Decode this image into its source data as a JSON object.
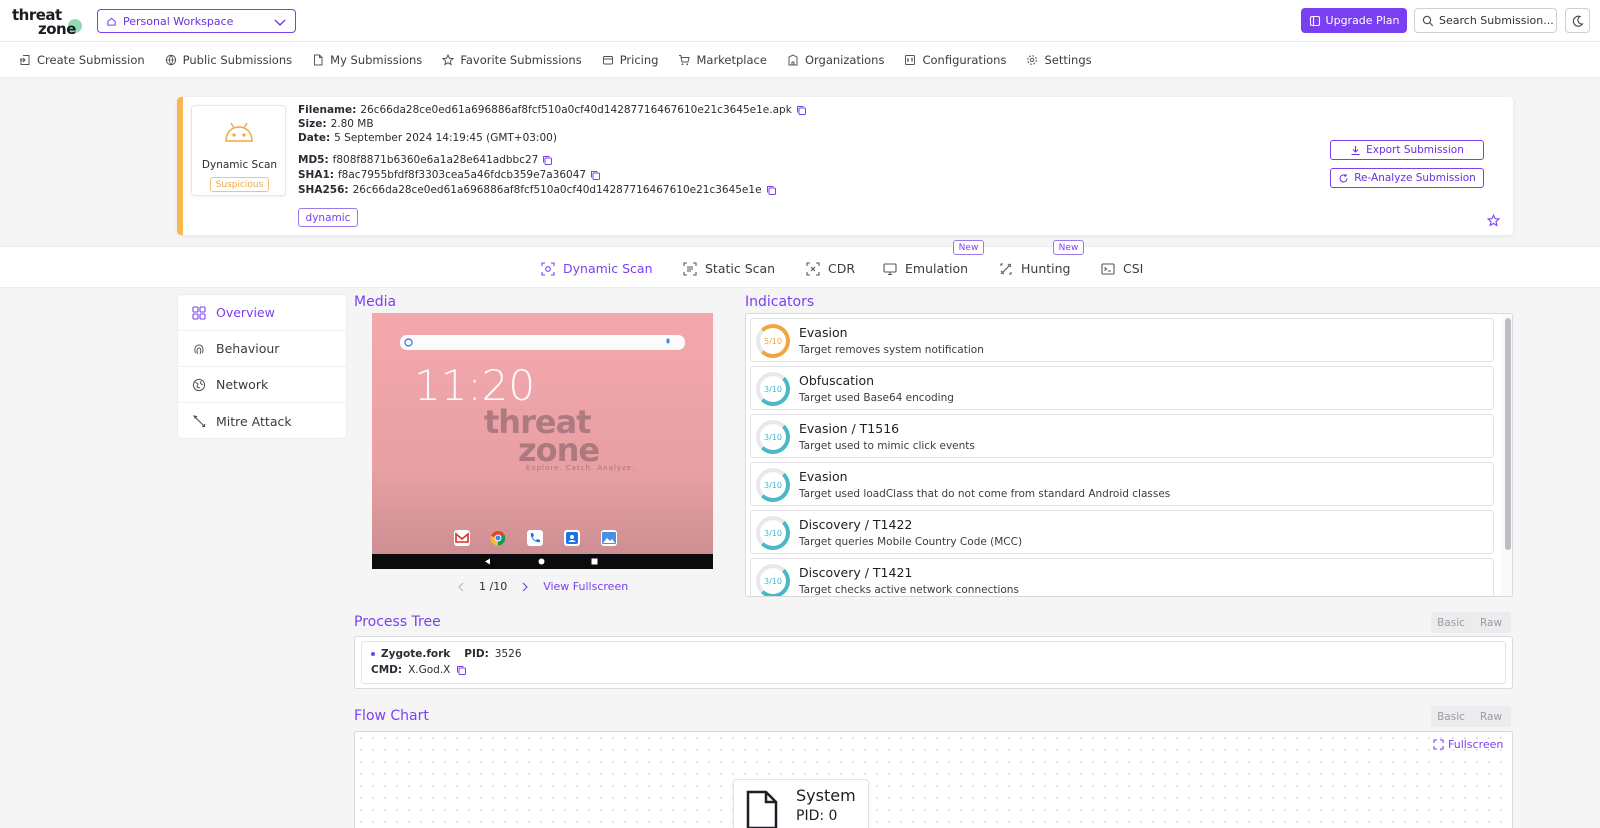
{
  "brand": {
    "logo_line1": "threat",
    "logo_line2": "zone"
  },
  "header": {
    "workspace": "Personal Workspace",
    "upgrade_label": "Upgrade Plan",
    "search_placeholder": "Search Submission..."
  },
  "nav": [
    {
      "label": "Create Submission",
      "icon": "create-submission-icon"
    },
    {
      "label": "Public Submissions",
      "icon": "public-icon"
    },
    {
      "label": "My Submissions",
      "icon": "file-icon"
    },
    {
      "label": "Favorite Submissions",
      "icon": "star-icon"
    },
    {
      "label": "Pricing",
      "icon": "pricing-icon"
    },
    {
      "label": "Marketplace",
      "icon": "cart-icon"
    },
    {
      "label": "Organizations",
      "icon": "building-icon"
    },
    {
      "label": "Configurations",
      "icon": "config-icon"
    },
    {
      "label": "Settings",
      "icon": "gear-icon"
    }
  ],
  "submission": {
    "scan_type": "Dynamic Scan",
    "verdict": "Suspicious",
    "filename_label": "Filename:",
    "filename": "26c66da28ce0ed61a696886af8fcf510a0cf40d14287716467610e21c3645e1e.apk",
    "size_label": "Size:",
    "size": "2.80 MB",
    "date_label": "Date:",
    "date": "5 September 2024 14:19:45 (GMT+03:00)",
    "md5_label": "MD5:",
    "md5": "f808f8871b6360e6a1a28e641adbbc27",
    "sha1_label": "SHA1:",
    "sha1": "f8ac7955bfdf8f3303cea5a46fdcb359e7a36047",
    "sha256_label": "SHA256:",
    "sha256": "26c66da28ce0ed61a696886af8fcf510a0cf40d14287716467610e21c3645e1e",
    "tag": "dynamic",
    "export_label": "Export Submission",
    "reanalyze_label": "Re-Analyze Submission",
    "accent_color": "#f7b94f"
  },
  "tabs": [
    {
      "label": "Dynamic Scan",
      "active": true
    },
    {
      "label": "Static Scan"
    },
    {
      "label": "CDR"
    },
    {
      "label": "Emulation",
      "badge": "New"
    },
    {
      "label": "Hunting",
      "badge": "New"
    },
    {
      "label": "CSI"
    }
  ],
  "side_menu": [
    {
      "label": "Overview",
      "active": true
    },
    {
      "label": "Behaviour"
    },
    {
      "label": "Network"
    },
    {
      "label": "Mitre Attack"
    }
  ],
  "media": {
    "title": "Media",
    "screen_time": "11:20",
    "watermark_line1": "threat",
    "watermark_line2": "zone",
    "watermark_tagline": "Explore. Catch. Analyze.",
    "page": "1 /10",
    "fullscreen_label": "View Fullscreen"
  },
  "indicators": {
    "title": "Indicators",
    "items": [
      {
        "score": "5/10",
        "title": "Evasion",
        "desc": "Target removes system notification",
        "color": "#f0a640"
      },
      {
        "score": "3/10",
        "title": "Obfuscation",
        "desc": "Target used Base64 encoding",
        "color": "#48b8c9"
      },
      {
        "score": "3/10",
        "title": "Evasion / T1516",
        "desc": "Target used to mimic click events",
        "color": "#48b8c9"
      },
      {
        "score": "3/10",
        "title": "Evasion",
        "desc": "Target used loadClass that do not come from standard Android classes",
        "color": "#48b8c9"
      },
      {
        "score": "3/10",
        "title": "Discovery / T1422",
        "desc": "Target queries Mobile Country Code (MCC)",
        "color": "#48b8c9"
      },
      {
        "score": "3/10",
        "title": "Discovery / T1421",
        "desc": "Target checks active network connections",
        "color": "#48b8c9"
      }
    ]
  },
  "process_tree": {
    "title": "Process Tree",
    "toggle": [
      "Basic",
      "Raw"
    ],
    "name": "Zygote.fork",
    "pid_label": "PID:",
    "pid": "3526",
    "cmd_label": "CMD:",
    "cmd": "X.God.X"
  },
  "flow_chart": {
    "title": "Flow Chart",
    "toggle": [
      "Basic",
      "Raw"
    ],
    "fullscreen_label": "Fullscreen",
    "node_title": "System",
    "node_pid": "PID: 0"
  },
  "colors": {
    "brand": "#7b3ff2",
    "suspicious": "#f0a640",
    "low": "#48b8c9"
  }
}
